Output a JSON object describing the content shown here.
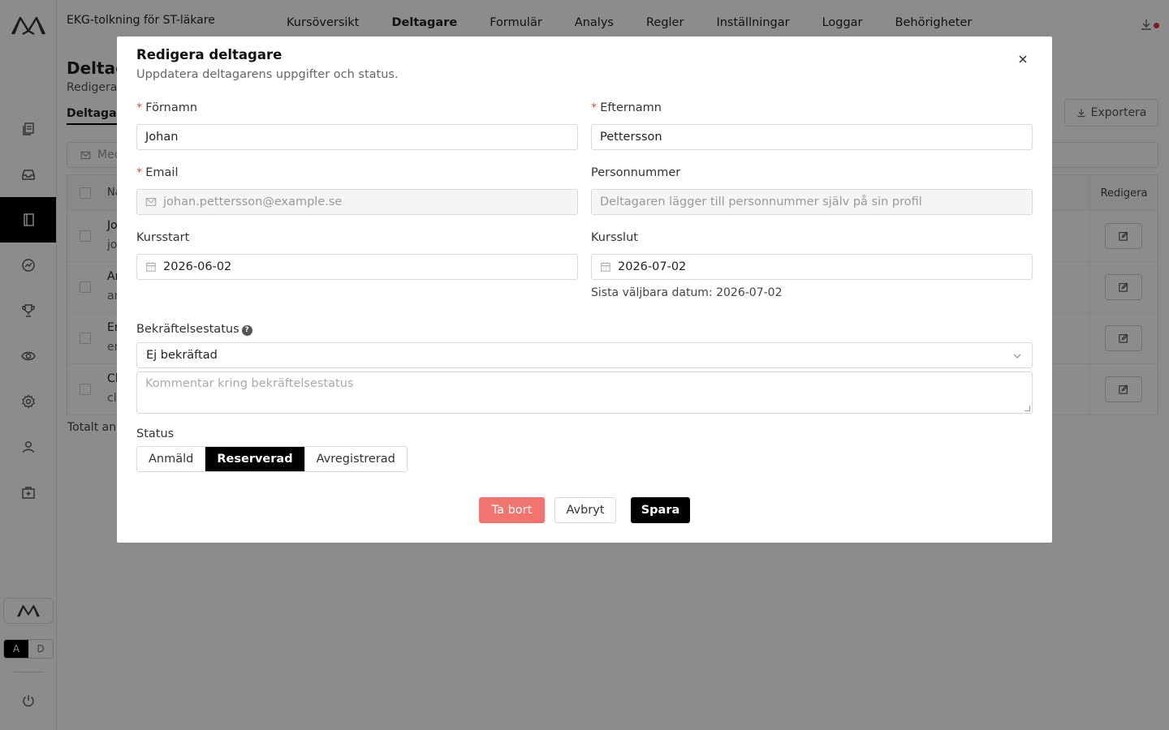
{
  "app": {
    "course_title": "EKG-tolkning för ST-läkare",
    "nav": [
      "Kursöversikt",
      "Deltagare",
      "Formulär",
      "Analys",
      "Regler",
      "Inställningar",
      "Loggar",
      "Behörigheter"
    ],
    "active_nav": "Deltagare",
    "sidebar_icons": [
      "documents-icon",
      "inbox-icon",
      "book-icon",
      "chart-icon",
      "trophy-icon",
      "eye-icon",
      "gear-icon",
      "user-icon",
      "medical-box-icon"
    ],
    "lang": {
      "a": "A",
      "d": "D"
    }
  },
  "page": {
    "title": "Deltagare",
    "subtitle": "Redigera",
    "tab": "Deltagare",
    "export_label": "Exportera",
    "search_placeholder": "Med",
    "table": {
      "col_name": "Na",
      "col_edit": "Redigera",
      "rows": [
        {
          "name": "Jo",
          "email": "jo"
        },
        {
          "name": "An",
          "email": "an"
        },
        {
          "name": "Er",
          "email": "er"
        },
        {
          "name": "Cl",
          "email": "cl"
        }
      ]
    },
    "total": "Totalt an"
  },
  "modal": {
    "title": "Redigera deltagare",
    "subtitle": "Uppdatera deltagarens uppgifter och status.",
    "first_name": {
      "label": "Förnamn",
      "value": "Johan",
      "required": true
    },
    "last_name": {
      "label": "Efternamn",
      "value": "Pettersson",
      "required": true
    },
    "email": {
      "label": "Email",
      "value": "johan.pettersson@example.se",
      "required": true
    },
    "personnummer": {
      "label": "Personnummer",
      "placeholder": "Deltagaren lägger till personnummer själv på sin profil"
    },
    "kursstart": {
      "label": "Kursstart",
      "value": "2026-06-02"
    },
    "kursslut": {
      "label": "Kursslut",
      "value": "2026-07-02",
      "hint": "Sista väljbara datum: 2026-07-02"
    },
    "confirmation": {
      "label": "Bekräftelsestatus",
      "value": "Ej bekräftad",
      "comment_placeholder": "Kommentar kring bekräftelsestatus"
    },
    "status": {
      "label": "Status",
      "options": [
        "Anmäld",
        "Reserverad",
        "Avregistrerad"
      ],
      "selected": "Reserverad"
    },
    "buttons": {
      "delete": "Ta bort",
      "cancel": "Avbryt",
      "save": "Spara"
    }
  },
  "colors": {
    "accent": "#000000",
    "danger": "#f07470",
    "required": "#e34d4d"
  }
}
